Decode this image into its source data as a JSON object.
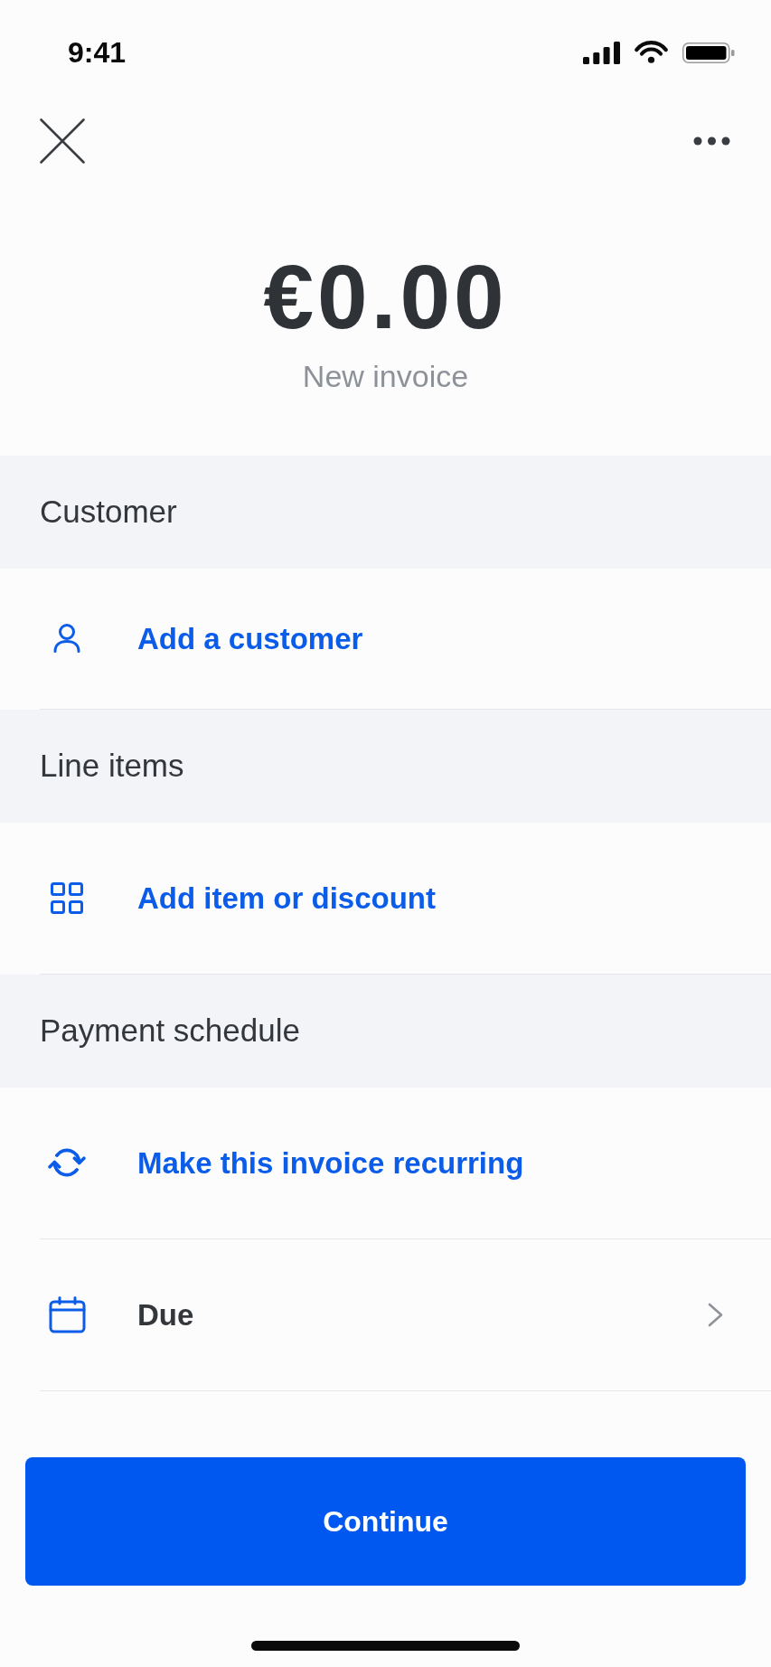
{
  "status_bar": {
    "time": "9:41"
  },
  "summary": {
    "amount": "€0.00",
    "subtitle": "New invoice"
  },
  "sections": [
    {
      "title": "Customer",
      "rows": [
        {
          "kind": "action",
          "label": "Add a customer"
        }
      ]
    },
    {
      "title": "Line items",
      "rows": [
        {
          "kind": "action",
          "label": "Add item or discount"
        }
      ]
    },
    {
      "title": "Payment schedule",
      "rows": [
        {
          "kind": "action",
          "label": "Make this invoice recurring"
        },
        {
          "kind": "field",
          "label": "Due"
        }
      ]
    }
  ],
  "primary_button": {
    "label": "Continue"
  }
}
